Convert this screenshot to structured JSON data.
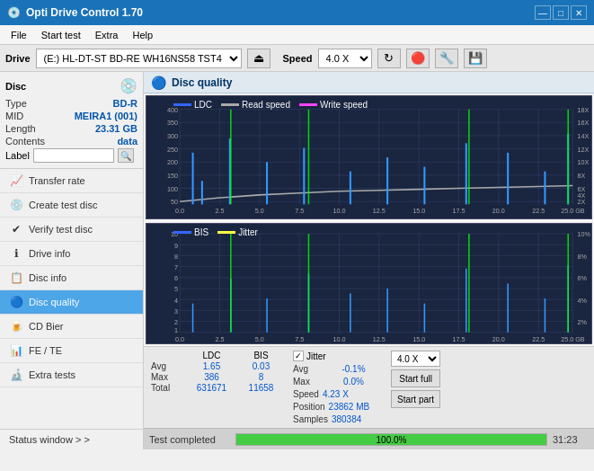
{
  "titlebar": {
    "title": "Opti Drive Control 1.70",
    "icon": "💿",
    "minimize": "—",
    "maximize": "□",
    "close": "✕"
  },
  "menubar": {
    "items": [
      "File",
      "Start test",
      "Extra",
      "Help"
    ]
  },
  "drivebar": {
    "label": "Drive",
    "drive_value": "(E:)  HL-DT-ST BD-RE  WH16NS58 TST4",
    "speed_label": "Speed",
    "speed_value": "4.0 X",
    "eject_icon": "⏏"
  },
  "sidebar": {
    "disc_label": "Disc",
    "disc_icon": "💿",
    "type_label": "Type",
    "type_value": "BD-R",
    "mid_label": "MID",
    "mid_value": "MEIRA1 (001)",
    "length_label": "Length",
    "length_value": "23.31 GB",
    "contents_label": "Contents",
    "contents_value": "data",
    "label_label": "Label",
    "label_placeholder": "",
    "nav_items": [
      {
        "id": "transfer-rate",
        "label": "Transfer rate",
        "icon": "📈"
      },
      {
        "id": "create-test-disc",
        "label": "Create test disc",
        "icon": "💿"
      },
      {
        "id": "verify-test-disc",
        "label": "Verify test disc",
        "icon": "✔"
      },
      {
        "id": "drive-info",
        "label": "Drive info",
        "icon": "ℹ"
      },
      {
        "id": "disc-info",
        "label": "Disc info",
        "icon": "📋"
      },
      {
        "id": "disc-quality",
        "label": "Disc quality",
        "icon": "🔵",
        "active": true
      },
      {
        "id": "cd-bier",
        "label": "CD Bier",
        "icon": "🍺"
      },
      {
        "id": "fe-te",
        "label": "FE / TE",
        "icon": "📊"
      },
      {
        "id": "extra-tests",
        "label": "Extra tests",
        "icon": "🔬"
      }
    ],
    "status_window": "Status window > >"
  },
  "content": {
    "title": "Disc quality",
    "icon": "🔵",
    "chart1": {
      "legend": [
        {
          "label": "LDC",
          "color": "#3366ff"
        },
        {
          "label": "Read speed",
          "color": "#aaaaaa"
        },
        {
          "label": "Write speed",
          "color": "#ff44ff"
        }
      ],
      "y_max": 400,
      "y_labels": [
        400,
        350,
        300,
        250,
        200,
        150,
        100,
        50
      ],
      "y_right_labels": [
        "18X",
        "16X",
        "14X",
        "12X",
        "10X",
        "8X",
        "6X",
        "4X",
        "2X"
      ],
      "x_labels": [
        "0.0",
        "2.5",
        "5.0",
        "7.5",
        "10.0",
        "12.5",
        "15.0",
        "17.5",
        "20.0",
        "22.5",
        "25.0 GB"
      ]
    },
    "chart2": {
      "legend": [
        {
          "label": "BIS",
          "color": "#3366ff"
        },
        {
          "label": "Jitter",
          "color": "#ffff44"
        }
      ],
      "y_max": 10,
      "y_labels": [
        10,
        9,
        8,
        7,
        6,
        5,
        4,
        3,
        2,
        1
      ],
      "y_right_labels": [
        "10%",
        "8%",
        "6%",
        "4%",
        "2%"
      ],
      "x_labels": [
        "0.0",
        "2.5",
        "5.0",
        "7.5",
        "10.0",
        "12.5",
        "15.0",
        "17.5",
        "20.0",
        "22.5",
        "25.0 GB"
      ]
    }
  },
  "stats": {
    "col_headers": [
      "LDC",
      "BIS",
      "",
      "Jitter"
    ],
    "rows": [
      {
        "label": "Avg",
        "ldc": "1.65",
        "bis": "0.03",
        "jitter": "-0.1%"
      },
      {
        "label": "Max",
        "ldc": "386",
        "bis": "8",
        "jitter": "0.0%"
      },
      {
        "label": "Total",
        "ldc": "631671",
        "bis": "11658",
        "jitter": ""
      }
    ],
    "jitter_label": "Jitter",
    "speed_label": "Speed",
    "speed_val": "4.23 X",
    "speed_select": "4.0 X",
    "position_label": "Position",
    "position_val": "23862 MB",
    "samples_label": "Samples",
    "samples_val": "380384",
    "start_full": "Start full",
    "start_part": "Start part"
  },
  "statusbar": {
    "status_text": "Test completed",
    "progress": 100,
    "progress_text": "100.0%",
    "time": "31:23"
  }
}
